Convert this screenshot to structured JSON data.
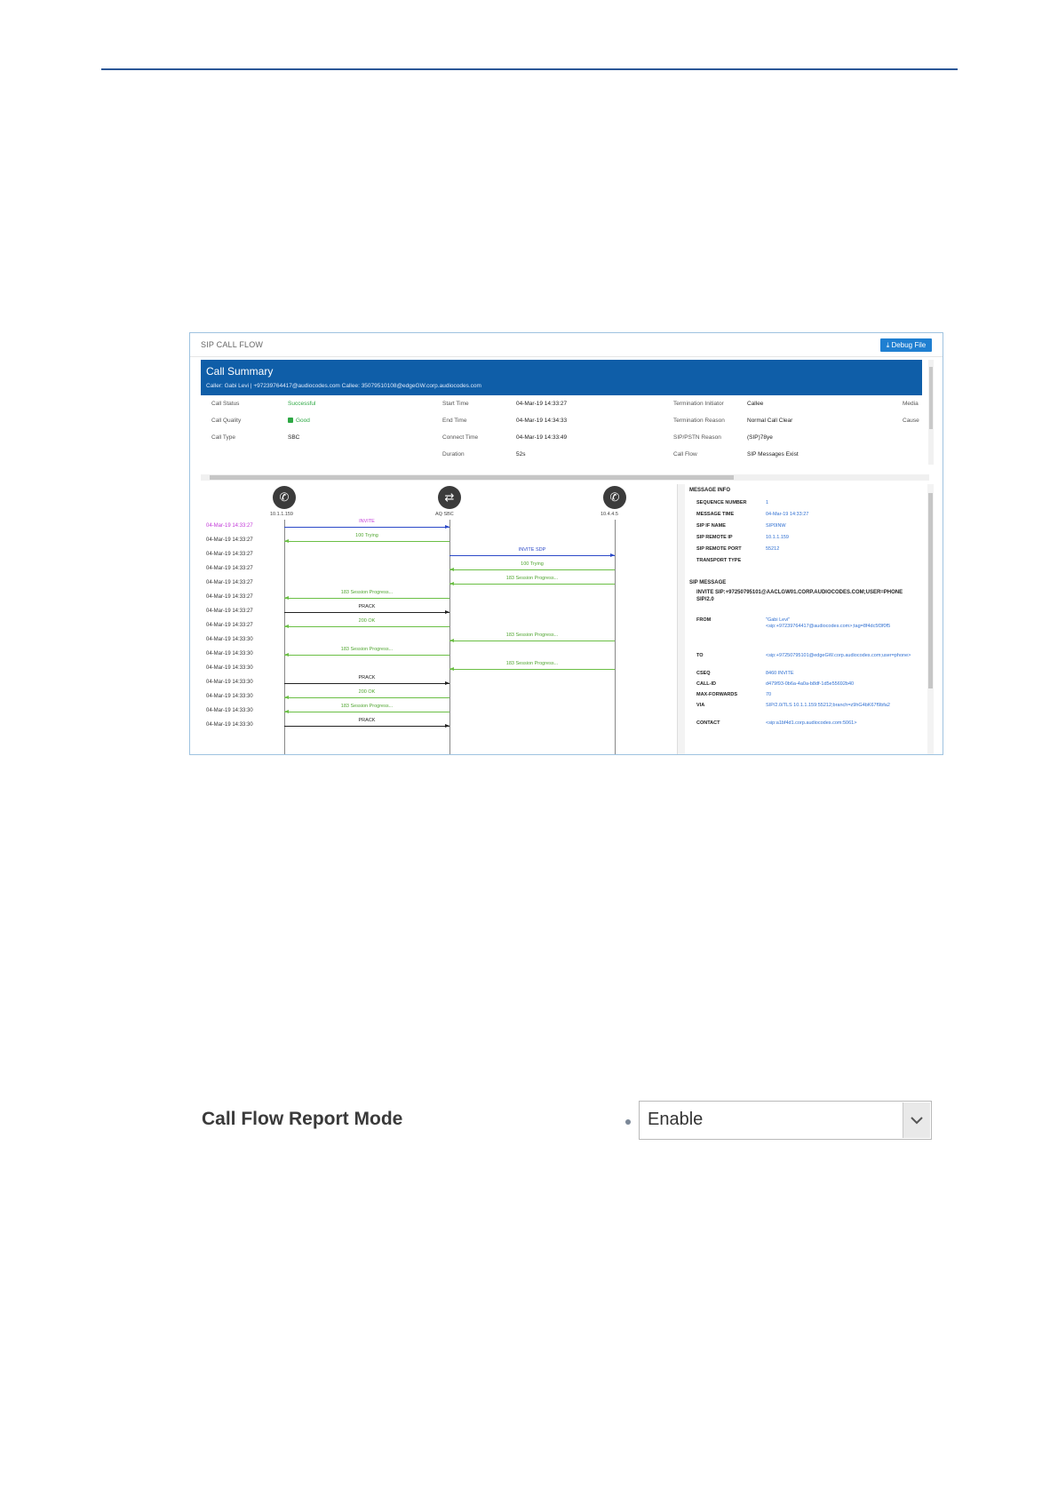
{
  "sip_panel": {
    "title": "SIP CALL FLOW",
    "debug_button": "Debug File",
    "summary": {
      "title": "Call Summary",
      "subline": "Caller: Gabi Levi | +97239764417@audiocodes.com  Callee: 35079510108@edgeGW.corp.audiocodes.com"
    },
    "info": [
      {
        "label": "Call Status",
        "value": "Successful"
      },
      {
        "label": "Call Quality",
        "value": "Good"
      },
      {
        "label": "Call Type",
        "value": "SBC"
      },
      {
        "label": "Start Time",
        "value": "04-Mar-19 14:33:27"
      },
      {
        "label": "End Time",
        "value": "04-Mar-19 14:34:33"
      },
      {
        "label": "Connect Time",
        "value": "04-Mar-19 14:33:49"
      },
      {
        "label": "Duration",
        "value": "52s"
      },
      {
        "label": "Termination Initiator",
        "value": "Callee"
      },
      {
        "label": "Termination Reason",
        "value": "Normal Call Clear"
      },
      {
        "label": "SIP/PSTN Reason",
        "value": "(SIP)78ye"
      },
      {
        "label": "Call Flow",
        "value": "SIP Messages Exist"
      },
      {
        "label": "Media",
        "value": ""
      },
      {
        "label": "Cause",
        "value": ""
      }
    ],
    "nodes": [
      {
        "label": "10.1.1.159"
      },
      {
        "label": "AQ SBC"
      },
      {
        "label": "10.4.4.5"
      }
    ],
    "timestamps": [
      "04-Mar-19 14:33:27",
      "04-Mar-19 14:33:27",
      "04-Mar-19 14:33:27",
      "04-Mar-19 14:33:27",
      "04-Mar-19 14:33:27",
      "04-Mar-19 14:33:27",
      "04-Mar-19 14:33:27",
      "04-Mar-19 14:33:27",
      "04-Mar-19 14:33:30",
      "04-Mar-19 14:33:30",
      "04-Mar-19 14:33:30",
      "04-Mar-19 14:33:30",
      "04-Mar-19 14:33:30",
      "04-Mar-19 14:33:30",
      "04-Mar-19 14:33:30"
    ],
    "messages": [
      {
        "label": "INVITE",
        "from": 0,
        "to": 1,
        "color": "magenta"
      },
      {
        "label": "100 Trying",
        "from": 1,
        "to": 0,
        "color": "green"
      },
      {
        "label": "INVITE SDP",
        "from": 1,
        "to": 2,
        "color": "blue"
      },
      {
        "label": "100 Trying",
        "from": 2,
        "to": 1,
        "color": "green"
      },
      {
        "label": "183 Session Progress...",
        "from": 2,
        "to": 1,
        "color": "green"
      },
      {
        "label": "183 Session Progress...",
        "from": 1,
        "to": 0,
        "color": "green"
      },
      {
        "label": "PRACK",
        "from": 0,
        "to": 1,
        "color": "black"
      },
      {
        "label": "200 OK",
        "from": 1,
        "to": 0,
        "color": "green"
      },
      {
        "label": "183 Session Progress...",
        "from": 2,
        "to": 1,
        "color": "green"
      },
      {
        "label": "183 Session Progress...",
        "from": 1,
        "to": 0,
        "color": "green"
      },
      {
        "label": "183 Session Progress...",
        "from": 2,
        "to": 1,
        "color": "green"
      },
      {
        "label": "PRACK",
        "from": 0,
        "to": 1,
        "color": "black"
      },
      {
        "label": "200 OK",
        "from": 1,
        "to": 0,
        "color": "green"
      },
      {
        "label": "183 Session Progress...",
        "from": 1,
        "to": 0,
        "color": "green"
      },
      {
        "label": "PRACK",
        "from": 0,
        "to": 1,
        "color": "black"
      }
    ],
    "details": {
      "message_info_heading": "MESSAGE INFO",
      "message_info": [
        {
          "key": "SEQUENCE NUMBER",
          "value": "1"
        },
        {
          "key": "MESSAGE TIME",
          "value": "04-Mar-19 14:33:27"
        },
        {
          "key": "SIP IF NAME",
          "value": "SIP0INW"
        },
        {
          "key": "SIP REMOTE IP",
          "value": "10.1.1.159"
        },
        {
          "key": "SIP REMOTE PORT",
          "value": "55212"
        },
        {
          "key": "TRANSPORT TYPE",
          "value": ""
        }
      ],
      "sip_message_heading": "SIP MESSAGE",
      "sip_request_line": "INVITE SIP:+97250795101@AACLGW01.CORP.AUDIOCODES.COM;USER=PHONE SIP/2.0",
      "sip_headers": [
        {
          "key": "FROM",
          "value": "\"Gabi Levi\"<sip:+97239764417@audiocodes.com>;tag=8f4dc5f3f0f5"
        },
        {
          "key": "TO",
          "value": "<sip:+97250795101@edgeGW.corp.audiocodes.com;user=phone>"
        },
        {
          "key": "CSEQ",
          "value": "8460 INVITE"
        },
        {
          "key": "CALL-ID",
          "value": "d479f93-0b6a-4a0a-b8df-1d5e55692b40"
        },
        {
          "key": "MAX-FORWARDS",
          "value": "70"
        },
        {
          "key": "VIA",
          "value": "SIP/2.0/TLS 10.1.1.159:55212;branch=z9hG4bK67f9bfa2"
        },
        {
          "key": "CONTACT",
          "value": "<sip:a1bf4d1.corp.audiocodes.com:5061>"
        }
      ]
    }
  },
  "parameter": {
    "label": "Call Flow Report Mode",
    "value": "Enable"
  }
}
